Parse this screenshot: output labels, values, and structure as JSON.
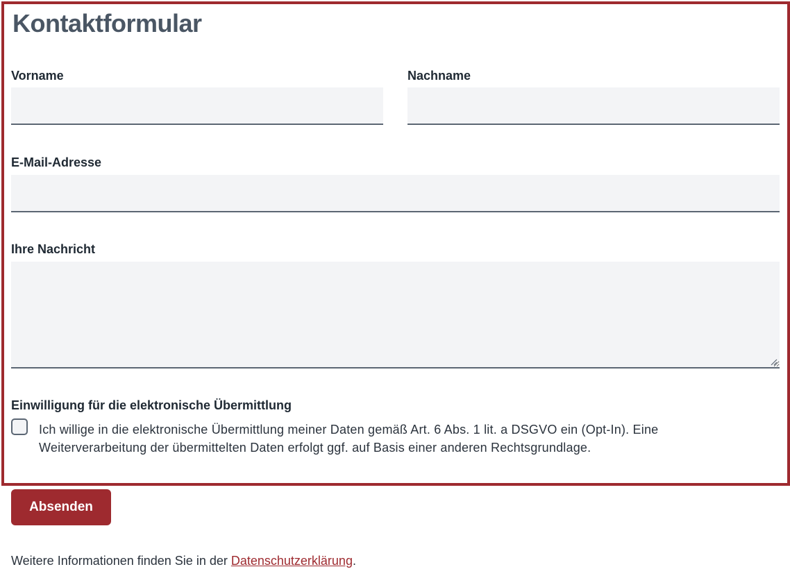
{
  "form": {
    "title": "Kontaktformular",
    "fields": {
      "first_name": {
        "label": "Vorname",
        "value": ""
      },
      "last_name": {
        "label": "Nachname",
        "value": ""
      },
      "email": {
        "label": "E-Mail-Adresse",
        "value": ""
      },
      "message": {
        "label": "Ihre Nachricht",
        "value": ""
      }
    },
    "consent": {
      "heading": "Einwilligung für die elektronische Übermittlung",
      "text": "Ich willige in die elektronische Übermittlung meiner Daten gemäß Art. 6 Abs. 1 lit. a DSGVO ein (Opt-In). Eine Weiterverarbeitung der übermittelten Daten erfolgt ggf. auf Basis einer anderen Rechtsgrundlage.",
      "checked": false
    },
    "submit_label": "Absenden"
  },
  "footer": {
    "prefix": "Weitere Informationen finden Sie in der ",
    "link_text": "Datenschutzerklärung",
    "suffix": "."
  },
  "colors": {
    "accent": "#9e2a2f",
    "title": "#4a5664",
    "field_bg": "#f3f4f6",
    "field_border": "#5b6673"
  }
}
